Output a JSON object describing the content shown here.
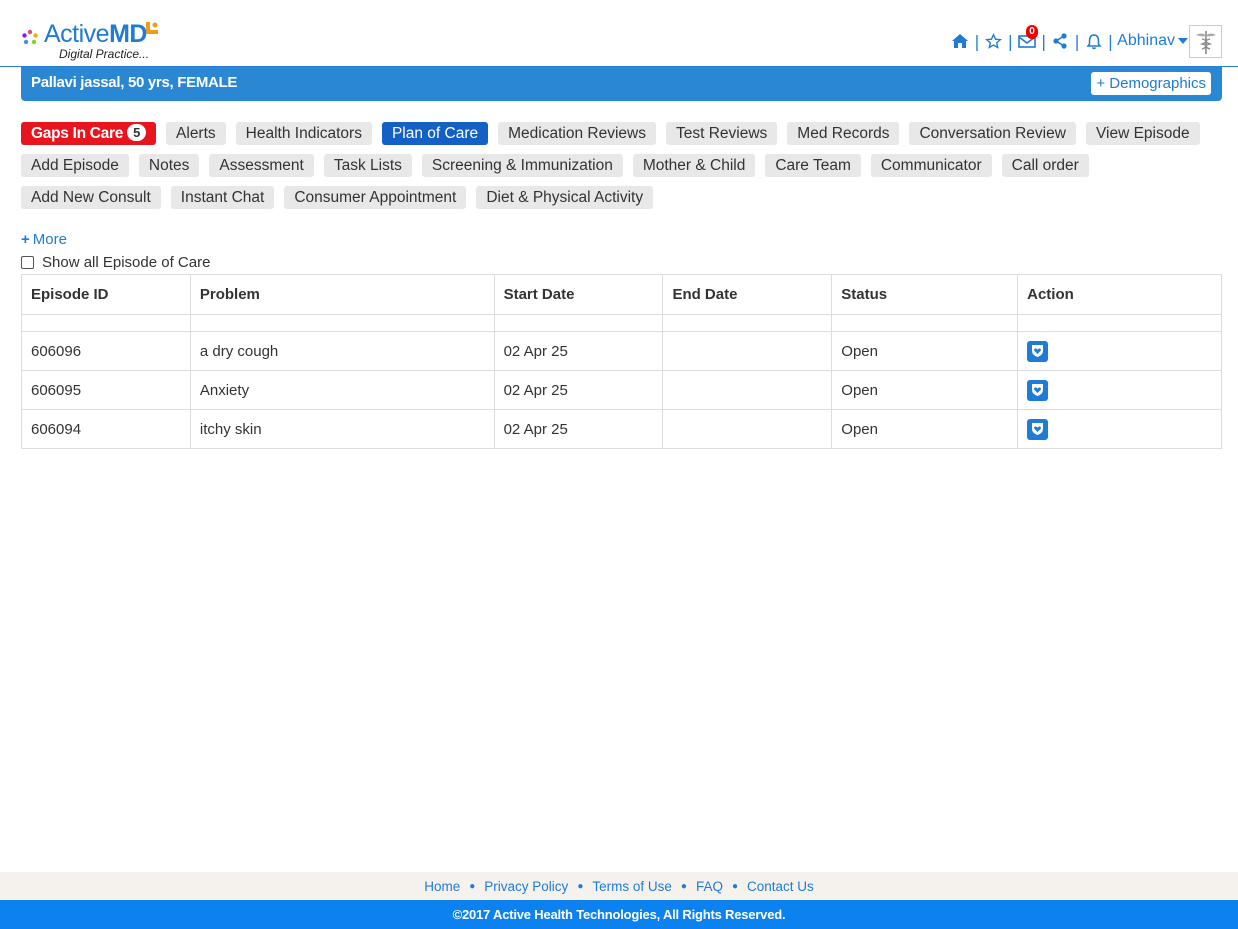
{
  "brand": {
    "name_light": "Active",
    "name_bold": "MD",
    "tagline": "Digital Practice..."
  },
  "topnav": {
    "icons": [
      "home-icon",
      "star-icon",
      "mail-icon",
      "share-icon",
      "bell-icon"
    ],
    "mail_count": "0",
    "user": "Abhinav"
  },
  "patient": {
    "summary": "Pallavi jassal, 50 yrs, FEMALE",
    "demographics_label": "+ Demographics"
  },
  "tabs": {
    "gaps_label": "Gaps In Care",
    "gaps_count": "5",
    "row1": [
      "Alerts",
      "Health Indicators",
      "Plan of Care",
      "Medication Reviews",
      "Test Reviews",
      "Med Records",
      "Conversation Review",
      "View Episode"
    ],
    "row2": [
      "Add Episode",
      "Notes",
      "Assessment",
      "Task Lists",
      "Screening & Immunization",
      "Mother & Child",
      "Care Team",
      "Communicator",
      "Call order"
    ],
    "row3": [
      "Add New Consult",
      "Instant Chat",
      "Consumer Appointment",
      "Diet & Physical Activity"
    ],
    "active": "Plan of Care"
  },
  "more_label": "More",
  "show_all_label": "Show all Episode of Care",
  "table": {
    "headers": [
      "Episode ID",
      "Problem",
      "Start Date",
      "End Date",
      "Status",
      "Action"
    ],
    "rows": [
      {
        "id": "606096",
        "problem": "a dry cough",
        "start": "02 Apr 25",
        "end": "",
        "status": "Open"
      },
      {
        "id": "606095",
        "problem": "Anxiety",
        "start": "02 Apr 25",
        "end": "",
        "status": "Open"
      },
      {
        "id": "606094",
        "problem": "itchy skin",
        "start": "02 Apr 25",
        "end": "",
        "status": "Open"
      }
    ]
  },
  "footer": {
    "links": [
      "Home",
      "Privacy Policy",
      "Terms of Use",
      "FAQ",
      "Contact Us"
    ],
    "copyright": "©2017 Active Health Technologies, All Rights Reserved."
  },
  "colors": {
    "brand_blue": "#1f7bd6",
    "bar_blue": "#2a87d4",
    "active_tab": "#1361c4",
    "gaps_red": "#e8151f",
    "footer_blue": "#0b82f0"
  }
}
